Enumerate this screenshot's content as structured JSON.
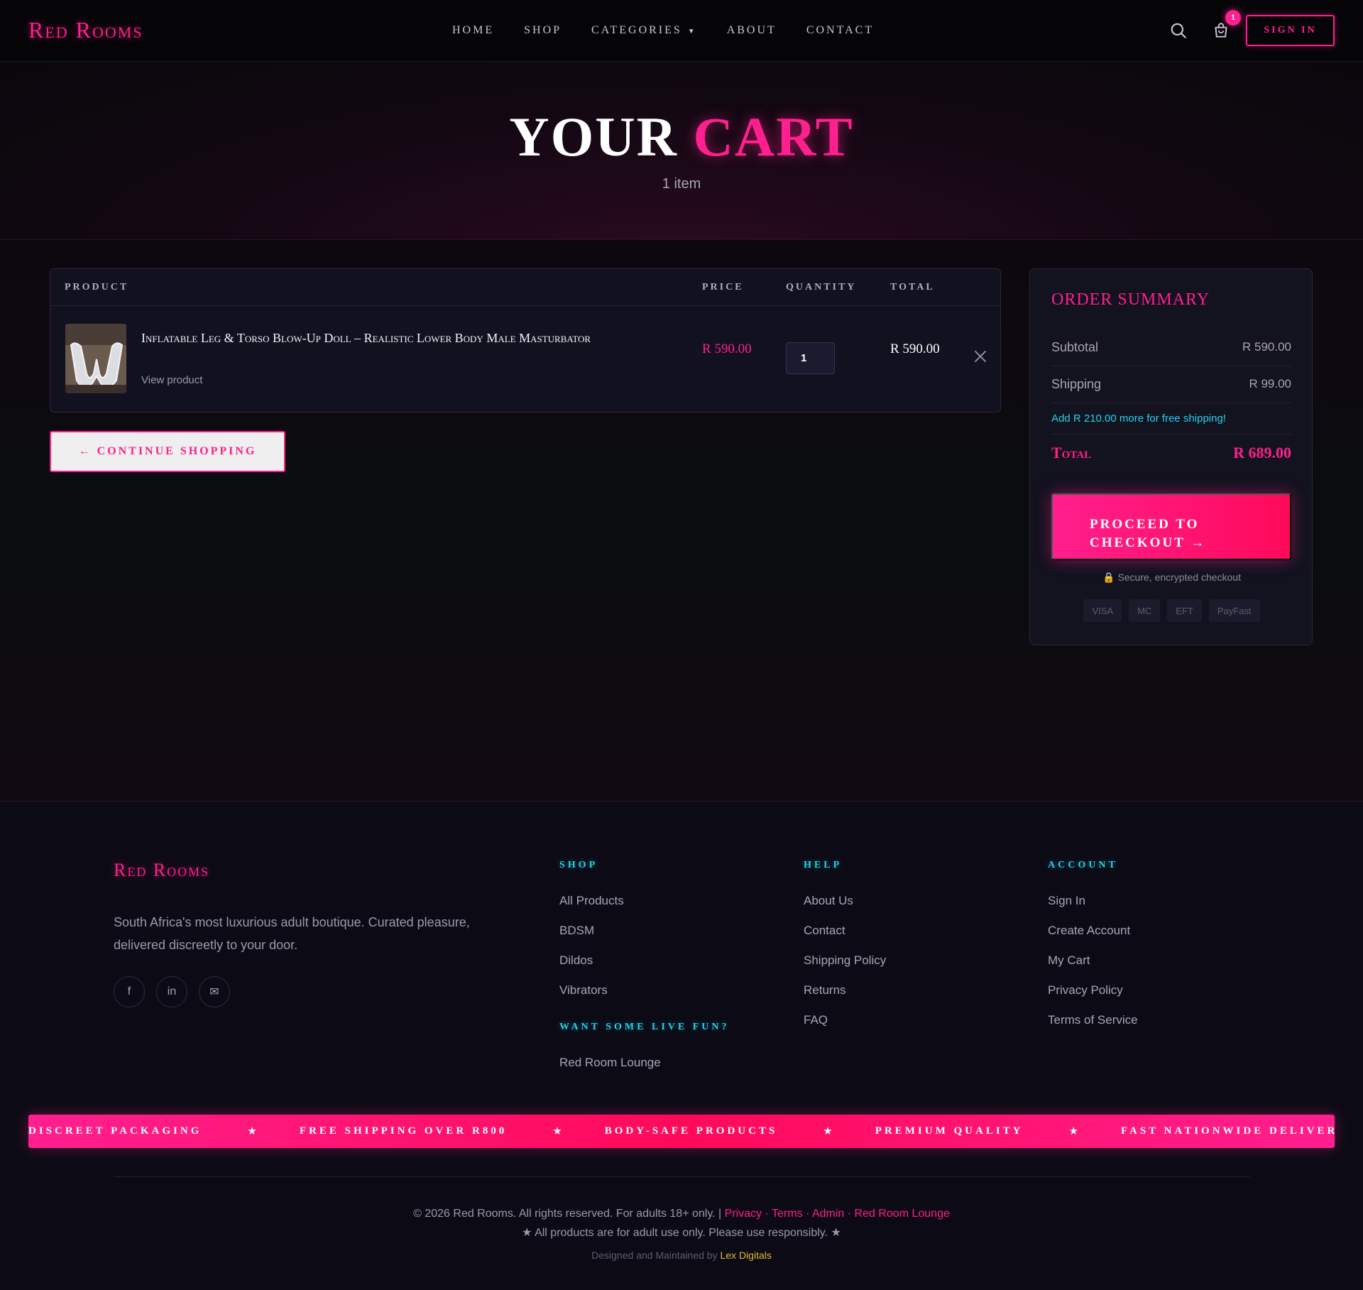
{
  "header": {
    "logo": "Red Rooms",
    "nav": [
      {
        "label": "HOME"
      },
      {
        "label": "SHOP"
      },
      {
        "label": "CATEGORIES"
      },
      {
        "label": "ABOUT"
      },
      {
        "label": "CONTACT"
      }
    ],
    "cart_count": "1",
    "sign_in": "SIGN IN"
  },
  "hero": {
    "title_plain": "YOUR",
    "title_accent": "CART",
    "subtitle": "1 item"
  },
  "cart": {
    "columns": {
      "product": "PRODUCT",
      "price": "PRICE",
      "quantity": "QUANTITY",
      "total": "TOTAL"
    },
    "items": [
      {
        "name": "Inflatable Leg & Torso Blow-Up Doll – Realistic Lower Body Male Masturbator",
        "link": "View product",
        "price": "R 590.00",
        "quantity": "1",
        "total": "R 590.00"
      }
    ],
    "continue": "← CONTINUE SHOPPING"
  },
  "summary": {
    "title": "Order Summary",
    "subtotal_label": "Subtotal",
    "subtotal_value": "R 590.00",
    "shipping_label": "Shipping",
    "shipping_value": "R 99.00",
    "free_shipping_note": "Add R 210.00 more for free shipping!",
    "total_label": "Total",
    "total_value": "R 689.00",
    "checkout_line1": "PROCEED TO",
    "checkout_line2": "CHECKOUT →",
    "secure_text": "Secure, encrypted checkout",
    "payment_methods": [
      "VISA",
      "MC",
      "EFT",
      "PayFast"
    ]
  },
  "footer": {
    "logo": "Red Rooms",
    "description": "South Africa's most luxurious adult boutique. Curated pleasure, delivered discreetly to your door.",
    "social": [
      "f",
      "in",
      "✉"
    ],
    "shop_heading": "SHOP",
    "shop_links": [
      "All Products",
      "BDSM",
      "Dildos",
      "Vibrators"
    ],
    "live_heading": "WANT SOME LIVE FUN?",
    "live_links": [
      "Red Room Lounge"
    ],
    "help_heading": "HELP",
    "help_links": [
      "About Us",
      "Contact",
      "Shipping Policy",
      "Returns",
      "FAQ"
    ],
    "account_heading": "ACCOUNT",
    "account_links": [
      "Sign In",
      "Create Account",
      "My Cart",
      "Privacy Policy",
      "Terms of Service"
    ],
    "marquee": [
      "DISCREET PACKAGING",
      "FREE SHIPPING OVER R800",
      "BODY-SAFE PRODUCTS",
      "PREMIUM QUALITY",
      "FAST NATIONWIDE DELIVERY"
    ],
    "copyright": "© 2026 Red Rooms. All rights reserved. For adults 18+ only. |",
    "legal_links": [
      "Privacy",
      "Terms",
      "Admin",
      "Red Room Lounge"
    ],
    "adult_note": "★ All products are for adult use only. Please use responsibly. ★",
    "designed_by": "Designed and Maintained by",
    "designer": "Lex Digitals"
  },
  "colors": {
    "accent": "#ff1f8e",
    "secondary": "#22d3ee",
    "background": "#0c0b14"
  }
}
